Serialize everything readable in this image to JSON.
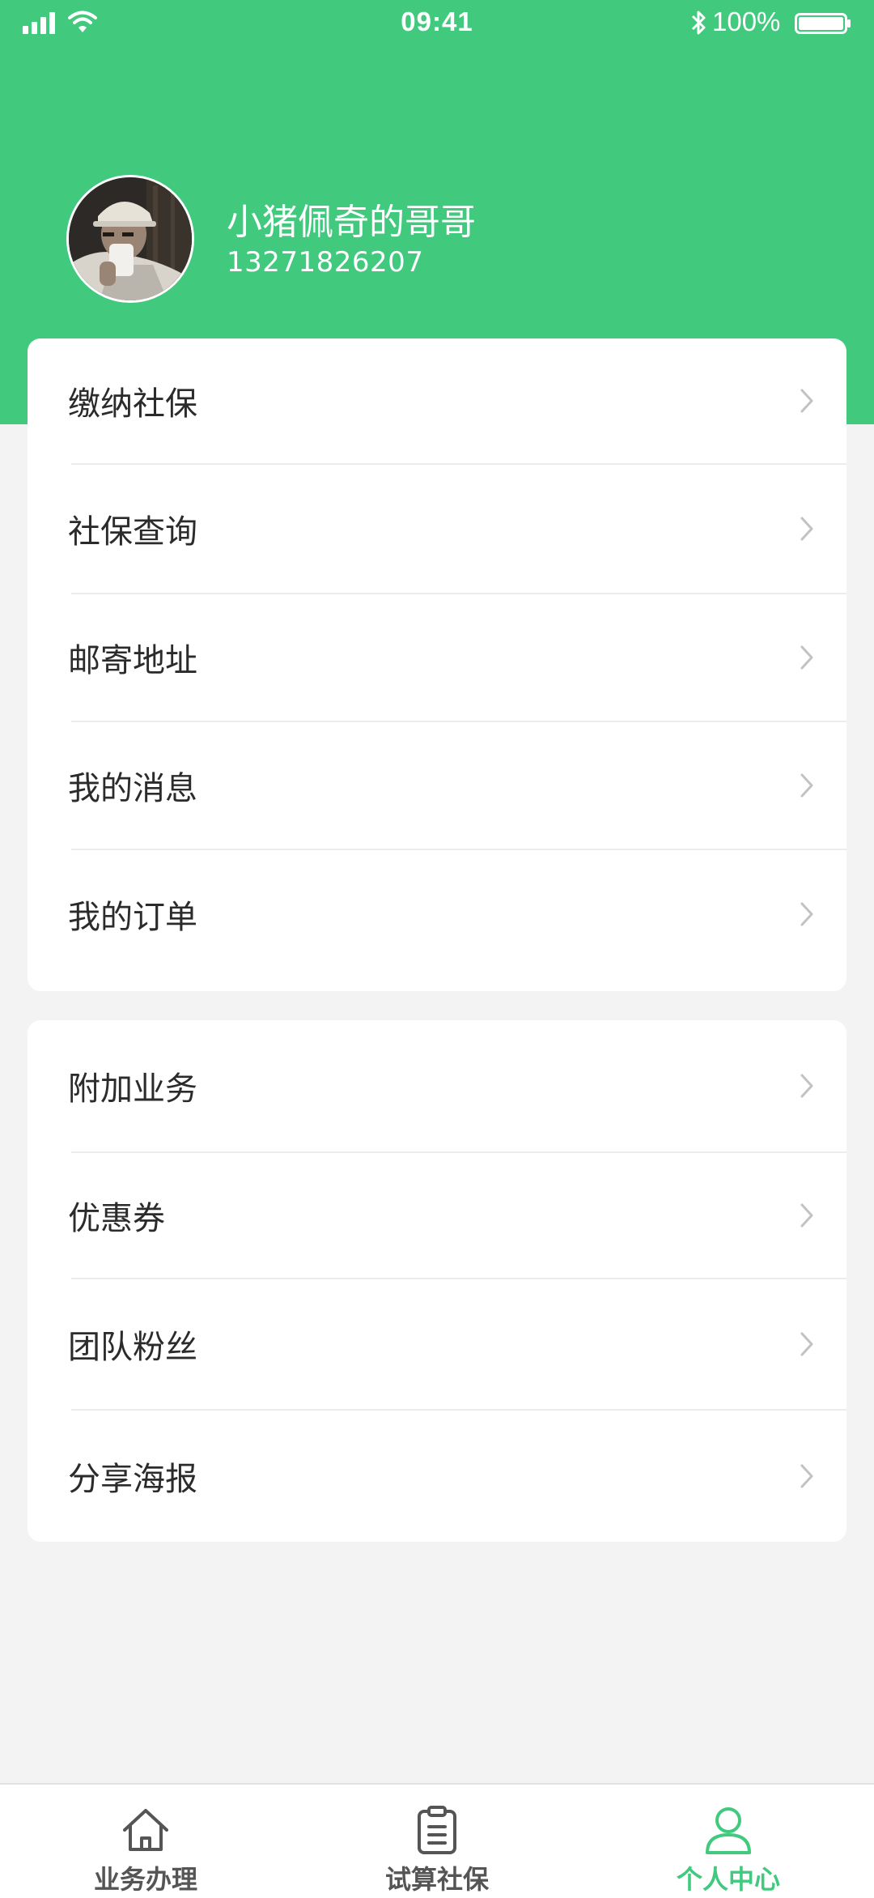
{
  "status_bar": {
    "time": "09:41",
    "battery": "100%"
  },
  "profile": {
    "name": "小猪佩奇的哥哥",
    "phone": "13271826207"
  },
  "menu_group_1": [
    {
      "label": "缴纳社保"
    },
    {
      "label": "社保查询"
    },
    {
      "label": "邮寄地址"
    },
    {
      "label": "我的消息"
    },
    {
      "label": "我的订单"
    }
  ],
  "menu_group_2": [
    {
      "label": "附加业务"
    },
    {
      "label": "优惠券"
    },
    {
      "label": "团队粉丝"
    },
    {
      "label": "分享海报"
    }
  ],
  "tab_bar": {
    "tabs": [
      {
        "label": "业务办理",
        "icon": "home-icon",
        "active": false
      },
      {
        "label": "试算社保",
        "icon": "clipboard-icon",
        "active": false
      },
      {
        "label": "个人中心",
        "icon": "person-icon",
        "active": true
      }
    ]
  },
  "colors": {
    "brand_green": "#41c97e",
    "background": "#f3f3f3",
    "inactive_tab": "#555555"
  }
}
